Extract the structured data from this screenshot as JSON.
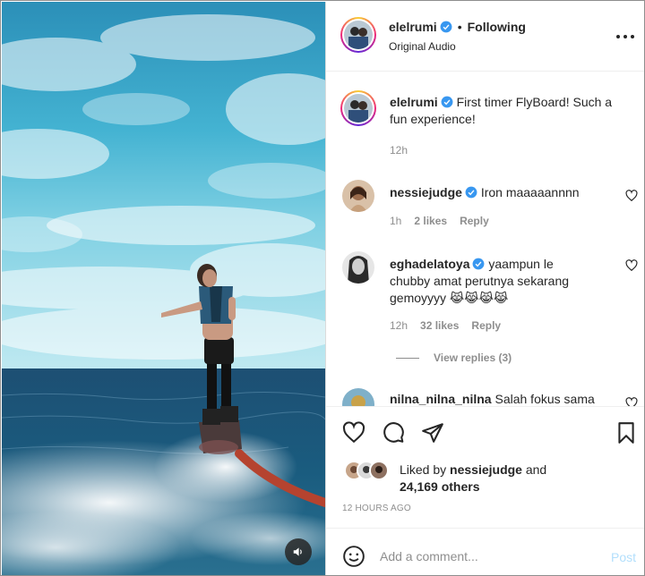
{
  "header": {
    "username": "elelrumi",
    "separator": "•",
    "follow_state": "Following",
    "audio": "Original Audio"
  },
  "caption": {
    "username": "elelrumi",
    "text": "First timer FlyBoard! Such a fun experience!",
    "age": "12h"
  },
  "comments": [
    {
      "username": "nessiejudge",
      "text": "Iron maaaaannnn",
      "age": "1h",
      "likes": "2 likes",
      "reply": "Reply"
    },
    {
      "username": "eghadelatoya",
      "text": "yaampun le chubby amat perutnya sekarang gemoyyyy 😹😹😹😹",
      "age": "12h",
      "likes": "32 likes",
      "reply": "Reply",
      "view_replies": "View replies (3)"
    },
    {
      "username": "nilna_nilna_nilna",
      "text": "Salah fokus sama"
    }
  ],
  "likes": {
    "prefix": "Liked by",
    "user": "nessiejudge",
    "joiner": "and",
    "others": "24,169 others"
  },
  "timestamp": "12 hours ago",
  "add_comment": {
    "placeholder": "Add a comment...",
    "post": "Post"
  },
  "icons": {
    "header_more": "more-options-icon",
    "verified": "verified-badge-icon",
    "like": "heart-icon",
    "comment": "comment-bubble-icon",
    "share": "paper-plane-icon",
    "save": "bookmark-icon",
    "emoji": "smiley-icon",
    "mute": "speaker-icon"
  },
  "colors": {
    "verified_blue": "#3897f0",
    "text": "#262626",
    "muted": "#8e8e8e",
    "post_disabled": "#b2dffc"
  }
}
